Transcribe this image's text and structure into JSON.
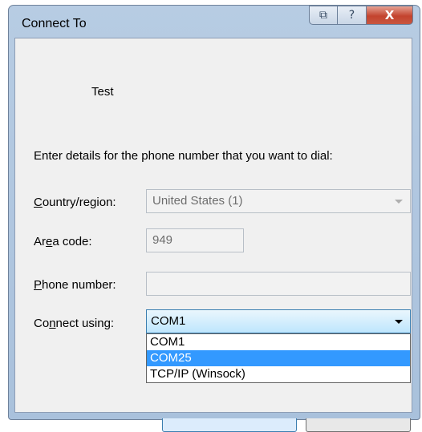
{
  "window": {
    "title": "Connect To",
    "restore_glyph": "⧉",
    "help_glyph": "?",
    "close_glyph": "X"
  },
  "entry_name": "Test",
  "prompt": "Enter details for the phone number that you want to dial:",
  "country": {
    "label": "Country/region:",
    "value": "United States (1)"
  },
  "area_code": {
    "label": "Area code:",
    "value": "949"
  },
  "phone_number": {
    "label": "Phone number:",
    "value": ""
  },
  "connect_using": {
    "label": "Connect using:",
    "value": "COM1",
    "options": [
      "COM1",
      "COM25",
      "TCP/IP (Winsock)"
    ],
    "highlighted": "COM25"
  },
  "colors": {
    "highlight": "#3399ff",
    "close_button": "#c3432e"
  }
}
